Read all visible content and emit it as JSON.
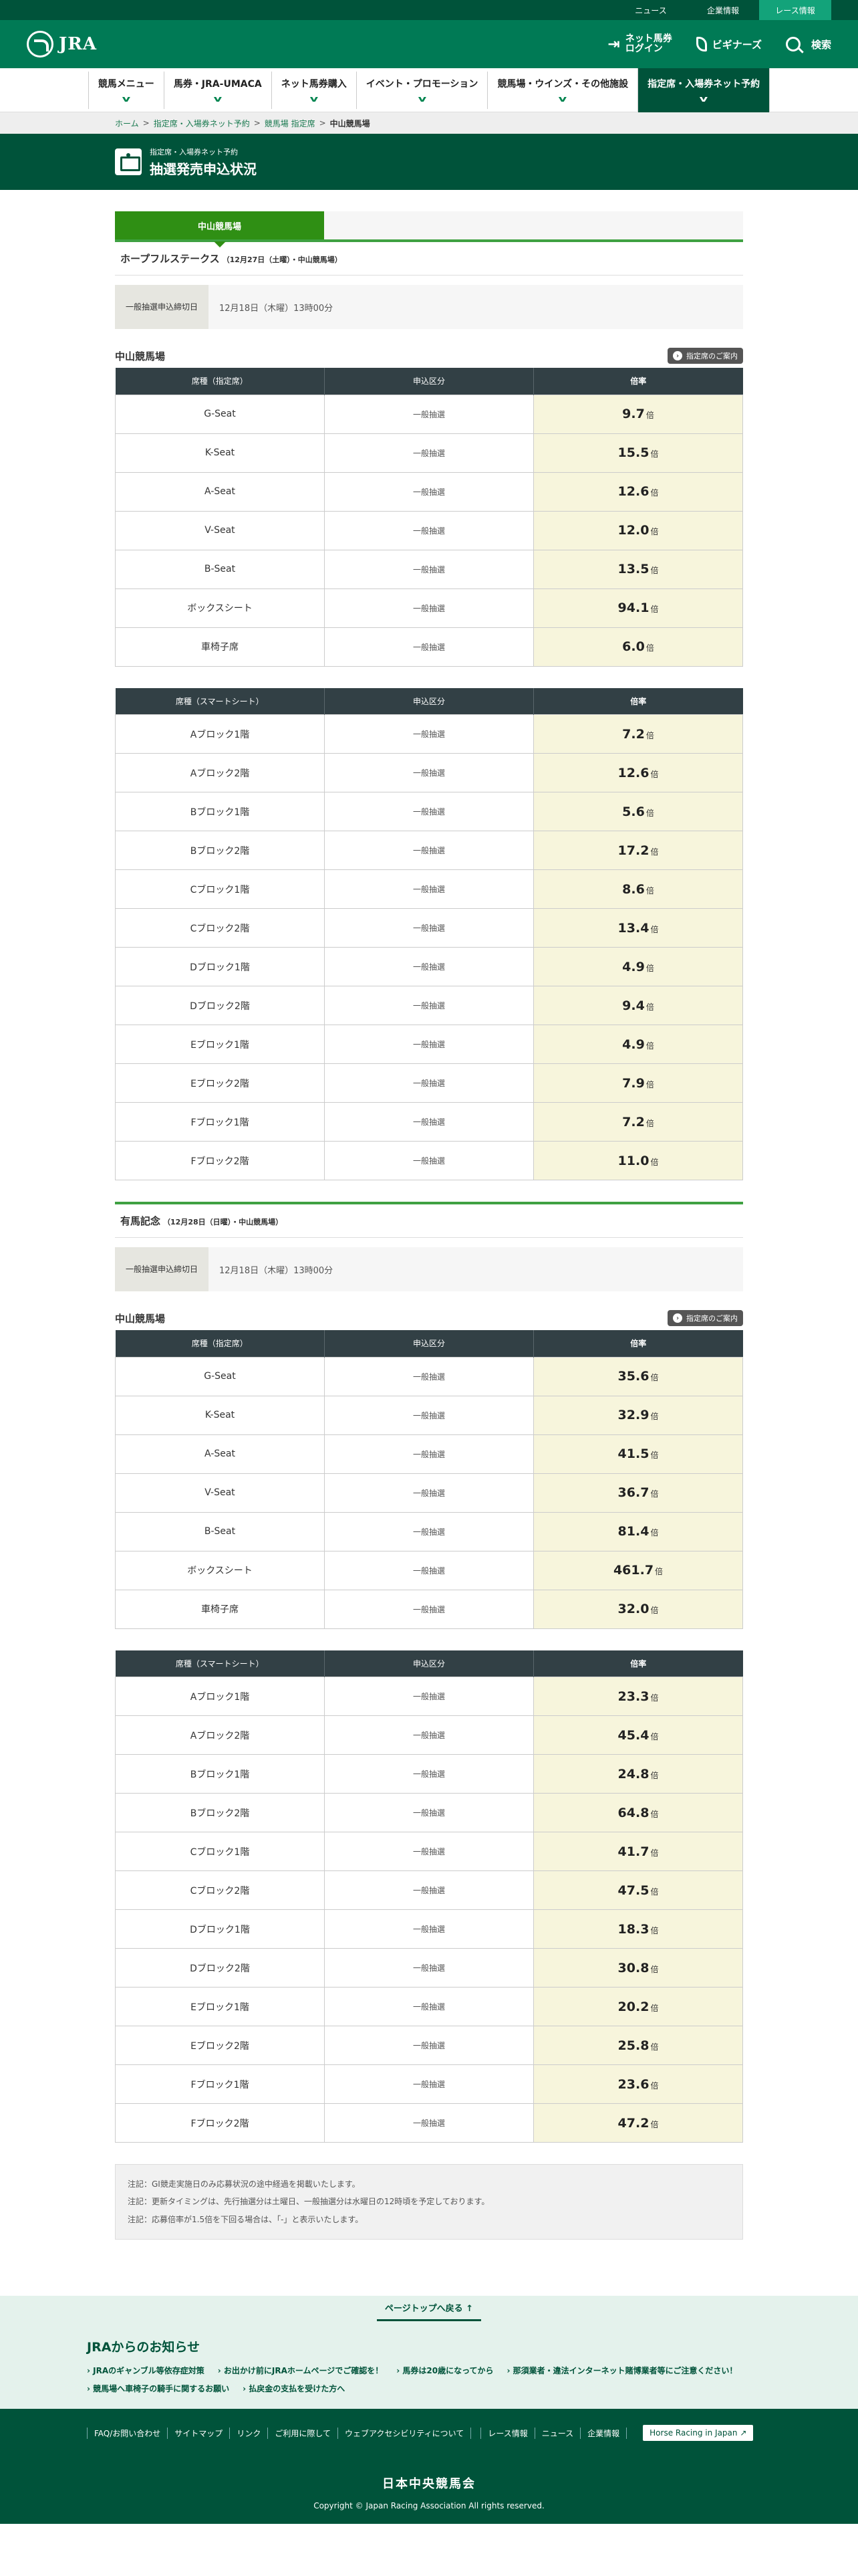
{
  "topbar": {
    "items": [
      "ニュース",
      "企業情報",
      "レース情報"
    ]
  },
  "header": {
    "logo_text": "JRA",
    "login_label_1": "ネット馬券",
    "login_label_2": "ログイン",
    "beginners_label": "ビギナーズ",
    "search_label": "検索"
  },
  "gnav": {
    "items": [
      "競馬メニュー",
      "馬券・JRA-UMACA",
      "ネット馬券購入",
      "イベント・プロモーション",
      "競馬場・ウインズ・その他施設",
      "指定席・入場券ネット予約"
    ]
  },
  "breadcrumb": {
    "items": [
      "ホーム",
      "指定席・入場券ネット予約",
      "競馬場 指定席"
    ],
    "current": "中山競馬場",
    "separator": ">"
  },
  "page_title": {
    "small": "指定席・入場券ネット予約",
    "big": "抽選発売申込状況"
  },
  "tab": {
    "label": "中山競馬場"
  },
  "table_headers": {
    "seat_reserved": "席種（指定席）",
    "seat_smart": "席種（スマートシート）",
    "kind": "申込区分",
    "rate": "倍率"
  },
  "guide_label": "指定席のご案内",
  "races": [
    {
      "name": "ホープフルステークス",
      "sub": "（12月27日（土曜）・中山競馬場）",
      "deadline_label_1": "一般抽選",
      "deadline_label_2": "申込締切日",
      "deadline_value": "12月18日（木曜）13時00分",
      "venue": "中山競馬場",
      "reserved": [
        {
          "seat": "G-Seat",
          "kind": "一般抽選",
          "rate": "9.7"
        },
        {
          "seat": "K-Seat",
          "kind": "一般抽選",
          "rate": "15.5"
        },
        {
          "seat": "A-Seat",
          "kind": "一般抽選",
          "rate": "12.6"
        },
        {
          "seat": "V-Seat",
          "kind": "一般抽選",
          "rate": "12.0"
        },
        {
          "seat": "B-Seat",
          "kind": "一般抽選",
          "rate": "13.5"
        },
        {
          "seat": "ボックスシート",
          "kind": "一般抽選",
          "rate": "94.1"
        },
        {
          "seat": "車椅子席",
          "kind": "一般抽選",
          "rate": "6.0"
        }
      ],
      "smart": [
        {
          "seat": "Aブロック1階",
          "kind": "一般抽選",
          "rate": "7.2"
        },
        {
          "seat": "Aブロック2階",
          "kind": "一般抽選",
          "rate": "12.6"
        },
        {
          "seat": "Bブロック1階",
          "kind": "一般抽選",
          "rate": "5.6"
        },
        {
          "seat": "Bブロック2階",
          "kind": "一般抽選",
          "rate": "17.2"
        },
        {
          "seat": "Cブロック1階",
          "kind": "一般抽選",
          "rate": "8.6"
        },
        {
          "seat": "Cブロック2階",
          "kind": "一般抽選",
          "rate": "13.4"
        },
        {
          "seat": "Dブロック1階",
          "kind": "一般抽選",
          "rate": "4.9"
        },
        {
          "seat": "Dブロック2階",
          "kind": "一般抽選",
          "rate": "9.4"
        },
        {
          "seat": "Eブロック1階",
          "kind": "一般抽選",
          "rate": "4.9"
        },
        {
          "seat": "Eブロック2階",
          "kind": "一般抽選",
          "rate": "7.9"
        },
        {
          "seat": "Fブロック1階",
          "kind": "一般抽選",
          "rate": "7.2"
        },
        {
          "seat": "Fブロック2階",
          "kind": "一般抽選",
          "rate": "11.0"
        }
      ]
    },
    {
      "name": "有馬記念",
      "sub": "（12月28日（日曜）・中山競馬場）",
      "deadline_label_1": "一般抽選",
      "deadline_label_2": "申込締切日",
      "deadline_value": "12月18日（木曜）13時00分",
      "venue": "中山競馬場",
      "reserved": [
        {
          "seat": "G-Seat",
          "kind": "一般抽選",
          "rate": "35.6"
        },
        {
          "seat": "K-Seat",
          "kind": "一般抽選",
          "rate": "32.9"
        },
        {
          "seat": "A-Seat",
          "kind": "一般抽選",
          "rate": "41.5"
        },
        {
          "seat": "V-Seat",
          "kind": "一般抽選",
          "rate": "36.7"
        },
        {
          "seat": "B-Seat",
          "kind": "一般抽選",
          "rate": "81.4"
        },
        {
          "seat": "ボックスシート",
          "kind": "一般抽選",
          "rate": "461.7"
        },
        {
          "seat": "車椅子席",
          "kind": "一般抽選",
          "rate": "32.0"
        }
      ],
      "smart": [
        {
          "seat": "Aブロック1階",
          "kind": "一般抽選",
          "rate": "23.3"
        },
        {
          "seat": "Aブロック2階",
          "kind": "一般抽選",
          "rate": "45.4"
        },
        {
          "seat": "Bブロック1階",
          "kind": "一般抽選",
          "rate": "24.8"
        },
        {
          "seat": "Bブロック2階",
          "kind": "一般抽選",
          "rate": "64.8"
        },
        {
          "seat": "Cブロック1階",
          "kind": "一般抽選",
          "rate": "41.7"
        },
        {
          "seat": "Cブロック2階",
          "kind": "一般抽選",
          "rate": "47.5"
        },
        {
          "seat": "Dブロック1階",
          "kind": "一般抽選",
          "rate": "18.3"
        },
        {
          "seat": "Dブロック2階",
          "kind": "一般抽選",
          "rate": "30.8"
        },
        {
          "seat": "Eブロック1階",
          "kind": "一般抽選",
          "rate": "20.2"
        },
        {
          "seat": "Eブロック2階",
          "kind": "一般抽選",
          "rate": "25.8"
        },
        {
          "seat": "Fブロック1階",
          "kind": "一般抽選",
          "rate": "23.6"
        },
        {
          "seat": "Fブロック2階",
          "kind": "一般抽選",
          "rate": "47.2"
        }
      ]
    }
  ],
  "rate_unit": "倍",
  "notes": [
    "注記：GI競走実施日のみ応募状況の途中経過を掲載いたします。",
    "注記：更新タイミングは、先行抽選分は土曜日、一般抽選分は水曜日の12時頃を予定しております。",
    "注記：応募倍率が1.5倍を下回る場合は、「-」と表示いたします。"
  ],
  "pagetop_label": "ページトップへ戻る",
  "info": {
    "title": "JRAからのお知らせ",
    "items": [
      "JRAのギャンブル等依存症対策",
      "お出かけ前にJRAホームページでご確認を！",
      "馬券は20歳になってから",
      "那須業者・違法インターネット賭博業者等にご注意ください！",
      "競馬場へ車椅子の騎手に関するお願い",
      "払戻金の支払を受けた方へ"
    ]
  },
  "footer": {
    "links_a": [
      "FAQ/お問い合わせ",
      "サイトマップ",
      "リンク",
      "ご利用に際して",
      "ウェブアクセシビリティについて"
    ],
    "links_b": [
      "レース情報",
      "ニュース",
      "企業情報"
    ],
    "english_label": "Horse Racing in Japan",
    "org": "日本中央競馬会",
    "copyright": "Copyright © Japan Racing Association All rights reserved."
  },
  "colors": {
    "brand_green": "#007a55",
    "dark_green": "#00533a",
    "tab_green": "#2f8f14",
    "rate_bg": "#f7f5dc",
    "table_head": "#324045"
  }
}
